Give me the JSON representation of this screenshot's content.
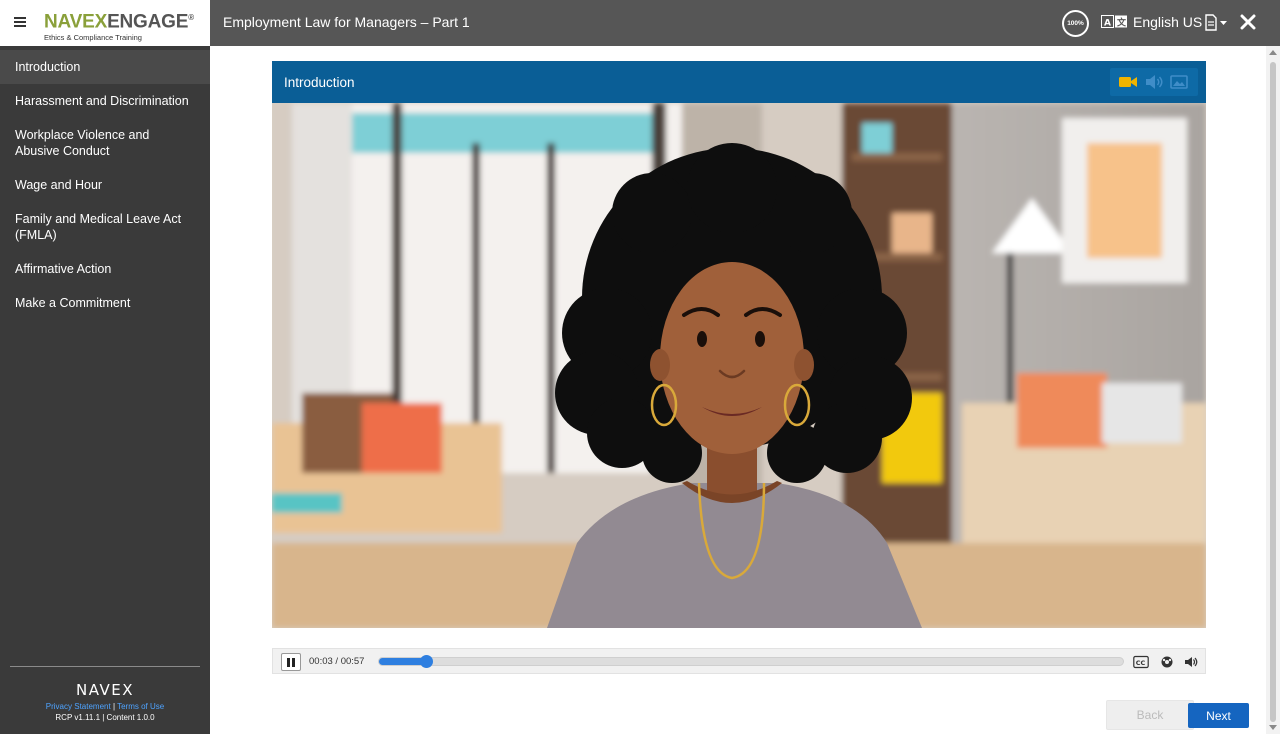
{
  "brand": {
    "name_part1": "NAVEX",
    "name_part2": "ENGAGE",
    "registered": "®",
    "tagline": "Ethics & Compliance Training"
  },
  "topbar": {
    "course_title": "Employment Law for Managers – Part 1",
    "zoom": "100%",
    "language": "English US",
    "icons": {
      "menu": "hamburger-icon",
      "translate": "translate-icon",
      "document": "document-icon",
      "dropdown": "chevron-down-icon",
      "close": "close-icon"
    }
  },
  "sidebar": {
    "items": [
      {
        "label": "Introduction",
        "active": true
      },
      {
        "label": "Harassment and Discrimination"
      },
      {
        "label": "Workplace Violence and Abusive Conduct"
      },
      {
        "label": "Wage and Hour"
      },
      {
        "label": "Family and Medical Leave Act (FMLA)"
      },
      {
        "label": "Affirmative Action"
      },
      {
        "label": "Make a Commitment"
      }
    ],
    "footer": {
      "logo": "NAVEX",
      "privacy": "Privacy Statement",
      "separator": "|",
      "terms": "Terms of Use",
      "version": "RCP v1.11.1 | Content 1.0.0"
    }
  },
  "lesson": {
    "title": "Introduction",
    "media_modes": [
      "video-icon",
      "audio-icon",
      "image-icon"
    ],
    "active_media_mode": "video-icon"
  },
  "player": {
    "time": "00:03 / 00:57",
    "progress": 0.063,
    "icons": [
      "pause-icon",
      "closed-captions-icon",
      "settings-icon",
      "volume-icon"
    ]
  },
  "navigation": {
    "back_label": "Back",
    "back_enabled": false,
    "next_label": "Next"
  },
  "colors": {
    "sidebar_bg": "#3a3a3a",
    "topbar_bg": "#565656",
    "lesson_header": "#0a5e96",
    "accent_blue": "#1565c0",
    "brand_green": "#8aa03a",
    "video_icon_active": "#f0b400"
  }
}
